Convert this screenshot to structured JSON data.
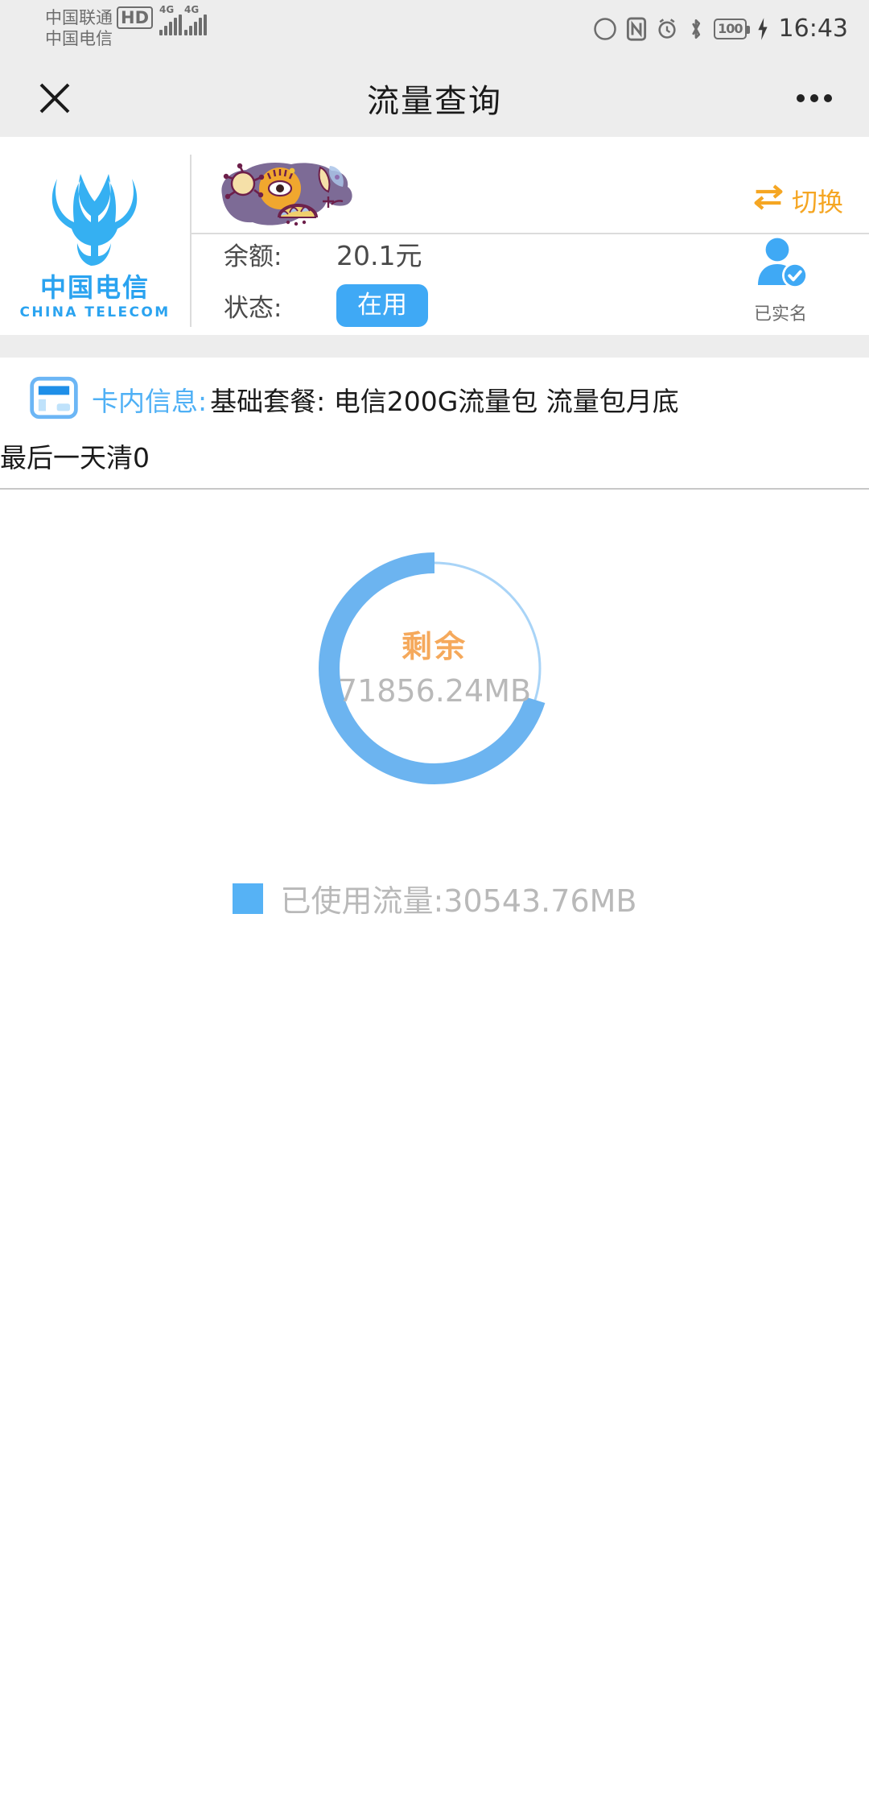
{
  "statusbar": {
    "carrier_primary": "中国联通",
    "carrier_secondary": "中国电信",
    "hd_badge": "HD",
    "signal_labels": [
      "4G",
      "4G"
    ],
    "battery_level": "100",
    "time": "16:43",
    "icons": [
      "eye-care-icon",
      "nfc-icon",
      "alarm-icon",
      "bluetooth-icon",
      "battery-icon",
      "charging-bolt-icon"
    ]
  },
  "header": {
    "close_icon": "close-icon",
    "title": "流量查询",
    "more_icon": "more-options-icon"
  },
  "account": {
    "logo_cn": "中国电信",
    "logo_en": "CHINA TELECOM",
    "sticker": "redaction-sticker",
    "switch_label": "切换",
    "switch_icon": "swap-arrows-icon",
    "balance_label": "余额:",
    "balance_value": "20.1元",
    "status_label": "状态:",
    "status_value": "在用",
    "verified_label": "已实名",
    "verified_icon": "user-verified-icon"
  },
  "card_info": {
    "icon": "sim-card-icon",
    "key": "卡内信息:",
    "value_line1": "基础套餐:  电信200G流量包 流量包月底",
    "value_line2": "最后一天清0"
  },
  "chart_data": {
    "type": "pie",
    "title": "剩余",
    "subtitle": "71856.24MB",
    "categories": [
      "剩余",
      "已使用流量"
    ],
    "values": [
      71856.24,
      30543.76
    ],
    "unit": "MB",
    "total": 102400.0,
    "remaining_fraction": 0.7017,
    "legend_position": "bottom",
    "legend": [
      {
        "label": "已使用流量:30543.76MB",
        "color": "#56b2f5"
      }
    ],
    "colors": {
      "arc": "#6cb4f0",
      "track": "#a9d4f7",
      "center_title": "#f5a95c",
      "center_value": "#b9b9b9"
    }
  },
  "colors": {
    "accent_blue": "#3fa9f5",
    "accent_orange": "#f5a623",
    "chart_blue": "#6cb4f0",
    "statusbar_bg": "#ededed"
  }
}
